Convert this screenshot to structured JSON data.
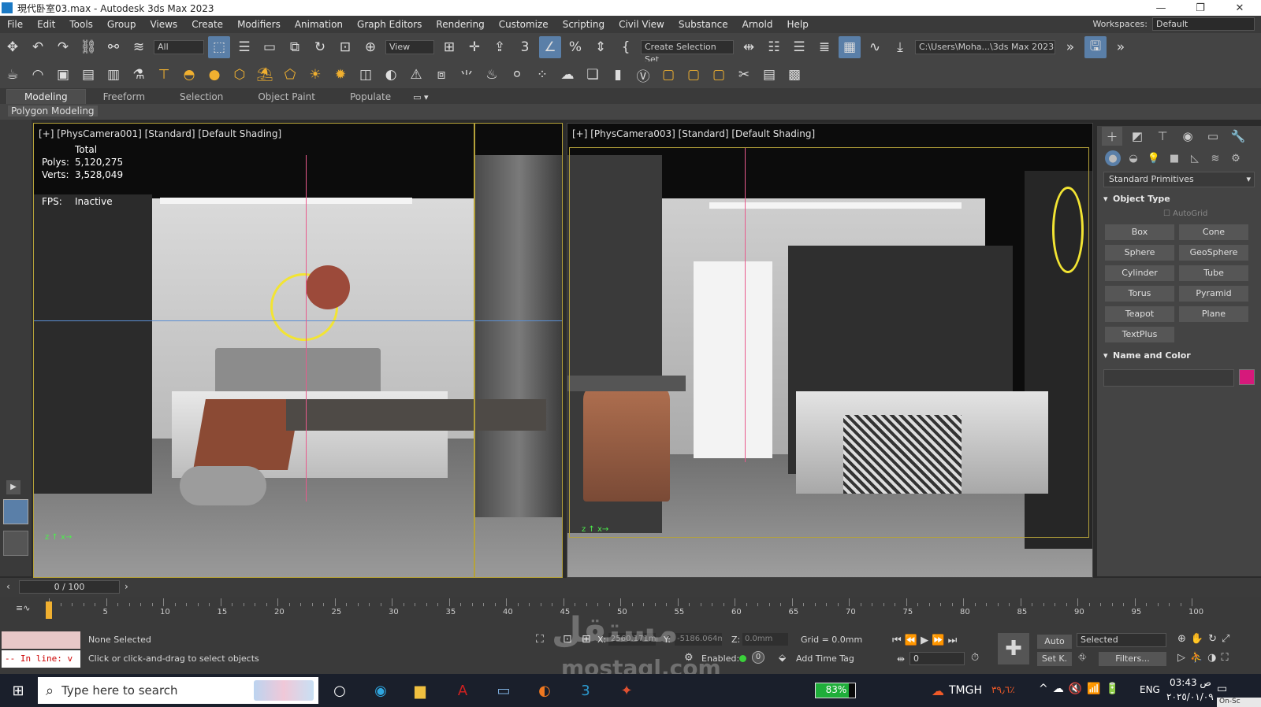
{
  "window": {
    "title": "現代卧室03.max - Autodesk 3ds Max 2023"
  },
  "menu": [
    "File",
    "Edit",
    "Tools",
    "Group",
    "Views",
    "Create",
    "Modifiers",
    "Animation",
    "Graph Editors",
    "Rendering",
    "Customize",
    "Scripting",
    "Civil View",
    "Substance",
    "Arnold",
    "Help"
  ],
  "workspaces": {
    "label": "Workspaces:",
    "value": "Default"
  },
  "toolbar": {
    "filter_value": "All",
    "view_value": "View",
    "selection_set_value": "Create Selection Set",
    "project_path": "C:\\Users\\Moha...\\3ds Max 2023"
  },
  "ribbon": {
    "tabs": [
      "Modeling",
      "Freeform",
      "Selection",
      "Object Paint",
      "Populate"
    ],
    "active_tab": "Modeling",
    "sub_label": "Polygon Modeling"
  },
  "viewport_left": {
    "label": "[+] [PhysCamera001] [Standard] [Default Shading]",
    "stats_total": "Total",
    "polys_label": "Polys:",
    "polys_value": "5,120,275",
    "verts_label": "Verts:",
    "verts_value": "3,528,049",
    "fps_label": "FPS:",
    "fps_value": "Inactive"
  },
  "viewport_right": {
    "label": "[+] [PhysCamera003] [Standard] [Default Shading]"
  },
  "command_panel": {
    "category": "Standard Primitives",
    "object_type_title": "Object Type",
    "autogrid": "AutoGrid",
    "buttons": [
      "Box",
      "Cone",
      "Sphere",
      "GeoSphere",
      "Cylinder",
      "Tube",
      "Torus",
      "Pyramid",
      "Teapot",
      "Plane",
      "TextPlus"
    ],
    "name_color_title": "Name and Color",
    "color": "#d6197b"
  },
  "time_slider": {
    "value": "0 / 100"
  },
  "timeline_ticks": [
    "0",
    "5",
    "10",
    "15",
    "20",
    "25",
    "30",
    "35",
    "40",
    "45",
    "50",
    "55",
    "60",
    "65",
    "70",
    "75",
    "80",
    "85",
    "90",
    "95",
    "100"
  ],
  "status": {
    "selection": "None Selected",
    "prompt": "Click or click-and-drag to select objects",
    "listener": "-- In line: v",
    "x_label": "X:",
    "x_value": "2560.171mm",
    "y_label": "Y:",
    "y_value": "-5186.064m",
    "z_label": "Z:",
    "z_value": "0.0mm",
    "grid": "Grid = 0.0mm",
    "enabled_label": "Enabled:",
    "add_time_tag": "Add Time Tag",
    "auto": "Auto",
    "setk": "Set K.",
    "key_mode": "Selected",
    "filters": "Filters...",
    "frame": "0"
  },
  "taskbar": {
    "search_placeholder": "Type here to search",
    "battery": "83%",
    "tmgh": "TMGH",
    "temp": "٣٩٫٦٪",
    "lang": "ENG",
    "time": "03:43 ص",
    "date": "٢٠٢٥/٠١/٠٩",
    "on_screen": "On-Sc"
  },
  "watermark": {
    "text1": "مستقل",
    "text2": "mostaql.com"
  }
}
